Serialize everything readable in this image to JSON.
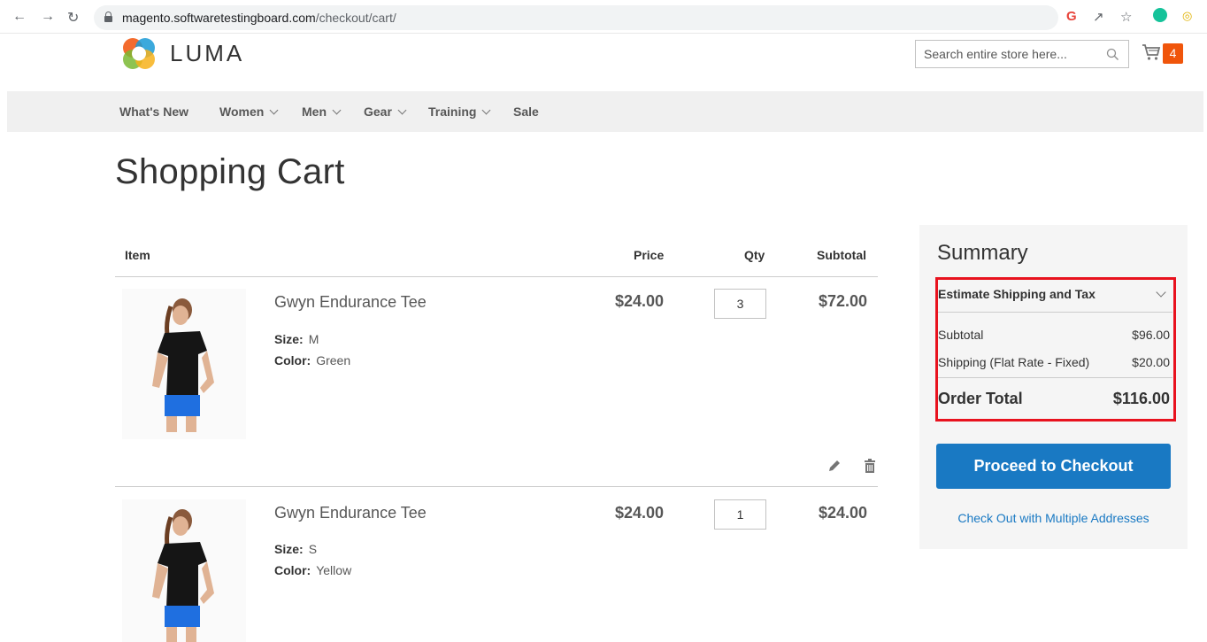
{
  "browser": {
    "url_host": "magento.softwaretestingboard.com",
    "url_path": "/checkout/cart/"
  },
  "header": {
    "logo_text": "LUMA",
    "search_placeholder": "Search entire store here...",
    "cart_count": "4"
  },
  "nav": {
    "items": [
      {
        "label": "What's New",
        "dropdown": false
      },
      {
        "label": "Women",
        "dropdown": true
      },
      {
        "label": "Men",
        "dropdown": true
      },
      {
        "label": "Gear",
        "dropdown": true
      },
      {
        "label": "Training",
        "dropdown": true
      },
      {
        "label": "Sale",
        "dropdown": false
      }
    ]
  },
  "page_title": "Shopping Cart",
  "cart": {
    "columns": {
      "item": "Item",
      "price": "Price",
      "qty": "Qty",
      "subtotal": "Subtotal"
    },
    "items": [
      {
        "name": "Gwyn Endurance Tee",
        "size_label": "Size:",
        "size": "M",
        "color_label": "Color:",
        "color": "Green",
        "price": "$24.00",
        "qty": "3",
        "subtotal": "$72.00"
      },
      {
        "name": "Gwyn Endurance Tee",
        "size_label": "Size:",
        "size": "S",
        "color_label": "Color:",
        "color": "Yellow",
        "price": "$24.00",
        "qty": "1",
        "subtotal": "$24.00"
      }
    ]
  },
  "summary": {
    "title": "Summary",
    "estimate_label": "Estimate Shipping and Tax",
    "subtotal_label": "Subtotal",
    "subtotal_value": "$96.00",
    "shipping_label": "Shipping (Flat Rate - Fixed)",
    "shipping_value": "$20.00",
    "total_label": "Order Total",
    "total_value": "$116.00",
    "checkout_button": "Proceed to Checkout",
    "multi_address_link": "Check Out with Multiple Addresses"
  },
  "colors": {
    "primary": "#1979c3",
    "highlight": "#e8121e",
    "cart_badge": "#f0550b"
  }
}
